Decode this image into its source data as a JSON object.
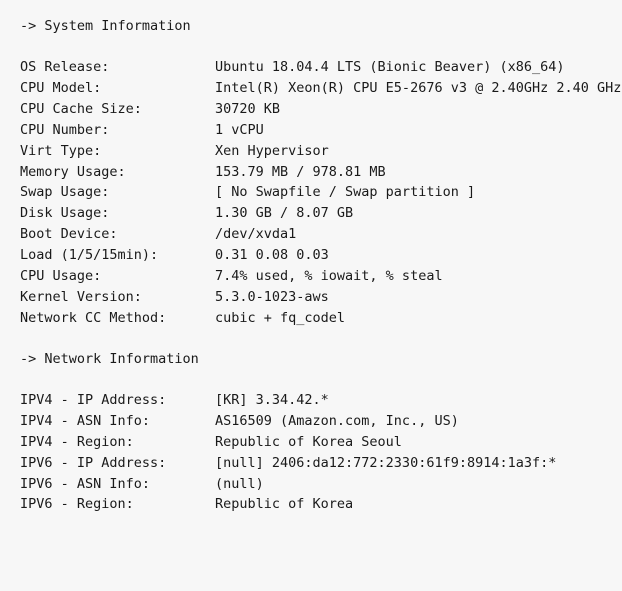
{
  "system_section": {
    "header": "-> System Information",
    "rows": [
      {
        "label": "OS Release:",
        "value": "Ubuntu 18.04.4 LTS (Bionic Beaver)  (x86_64)"
      },
      {
        "label": "CPU Model:",
        "value": "Intel(R) Xeon(R) CPU E5-2676 v3 @ 2.40GHz  2.40 GHz"
      },
      {
        "label": "CPU Cache Size:",
        "value": "30720 KB"
      },
      {
        "label": "CPU Number:",
        "value": "1 vCPU"
      },
      {
        "label": "Virt Type:",
        "value": "Xen Hypervisor"
      },
      {
        "label": "Memory Usage:",
        "value": "153.79 MB / 978.81 MB"
      },
      {
        "label": "Swap Usage:",
        "value": "[ No Swapfile / Swap partition ]"
      },
      {
        "label": "Disk Usage:",
        "value": "1.30 GB / 8.07 GB"
      },
      {
        "label": "Boot Device:",
        "value": "/dev/xvda1"
      },
      {
        "label": "Load (1/5/15min):",
        "value": "0.31 0.08 0.03"
      },
      {
        "label": "CPU Usage:",
        "value": "7.4% used, % iowait, % steal"
      },
      {
        "label": "Kernel Version:",
        "value": "5.3.0-1023-aws"
      },
      {
        "label": "Network CC Method:",
        "value": "cubic + fq_codel"
      }
    ]
  },
  "network_section": {
    "header": "-> Network Information",
    "rows": [
      {
        "label": "IPV4 - IP Address:",
        "value": "[KR] 3.34.42.*"
      },
      {
        "label": "IPV4 - ASN Info:",
        "value": "AS16509 (Amazon.com, Inc., US)"
      },
      {
        "label": "IPV4 - Region:",
        "value": "Republic of Korea Seoul"
      },
      {
        "label": "IPV6 - IP Address:",
        "value": "[null] 2406:da12:772:2330:61f9:8914:1a3f:*"
      },
      {
        "label": "IPV6 - ASN Info:",
        "value": " (null)"
      },
      {
        "label": "IPV6 - Region:",
        "value": " Republic of Korea"
      }
    ]
  }
}
